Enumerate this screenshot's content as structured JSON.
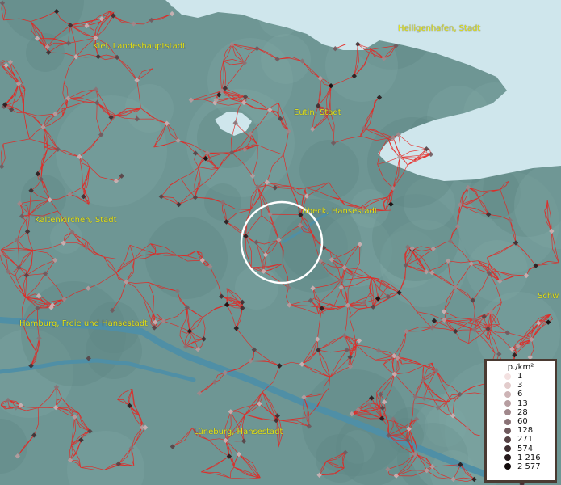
{
  "map": {
    "colors": {
      "water": "#cfe6ec",
      "land": "#6e9694",
      "boundary": "#e8221e",
      "label": "#e6e619",
      "highlight": "#ffffff"
    },
    "cities": [
      {
        "id": "kiel",
        "name": "Kiel, Landeshauptstadt"
      },
      {
        "id": "heiligenhafen",
        "name": "Heiligenhafen, Stadt"
      },
      {
        "id": "eutin",
        "name": "Eutin, Stadt"
      },
      {
        "id": "kaltenkirchen",
        "name": "Kaltenkirchen, Stadt"
      },
      {
        "id": "luebeck",
        "name": "Lübeck, Hansestadt"
      },
      {
        "id": "hamburg",
        "name": "Hamburg, Freie und Hansestadt"
      },
      {
        "id": "lueneburg",
        "name": "Lüneburg, Hansestadt"
      },
      {
        "id": "schwerin",
        "name": "Schw"
      }
    ],
    "legend": {
      "title": "p./km²",
      "entries": [
        {
          "label": "1",
          "color": "#f3e1e1"
        },
        {
          "label": "3",
          "color": "#e2cccc"
        },
        {
          "label": "6",
          "color": "#cdb4b6"
        },
        {
          "label": "13",
          "color": "#b79ea1"
        },
        {
          "label": "28",
          "color": "#a1888c"
        },
        {
          "label": "60",
          "color": "#8a7276"
        },
        {
          "label": "128",
          "color": "#705a5e"
        },
        {
          "label": "271",
          "color": "#574346"
        },
        {
          "label": "574",
          "color": "#3e2e31"
        },
        {
          "label": "1 216",
          "color": "#271b1d"
        },
        {
          "label": "2 577",
          "color": "#120a0b"
        }
      ]
    }
  }
}
